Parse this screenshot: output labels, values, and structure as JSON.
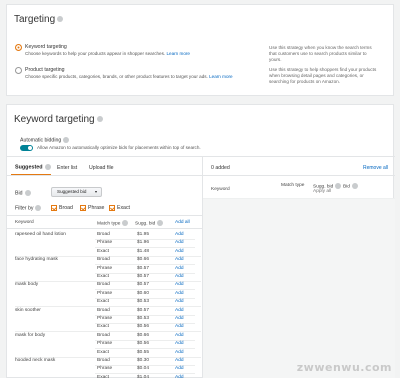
{
  "targeting": {
    "title": "Targeting",
    "auto_label": "Keyword targeting",
    "auto_desc": "Choose keywords to help your products appear in shopper searches.",
    "auto_link": "Learn more",
    "manual_label": "Product targeting",
    "manual_desc": "Choose specific products, categories, brands, or other product features to target your ads.",
    "manual_link": "Learn more",
    "side_text_1": "Use this strategy when you know the search terms",
    "side_text_2": "that customers use to search products similar to",
    "side_text_3": "yours.",
    "side_text_4": "Use this strategy to help shoppers find your products",
    "side_text_5": "when browsing detail pages and categories, or",
    "side_text_6": "searching for products on Amazon."
  },
  "keyword_targeting": {
    "title": "Keyword targeting",
    "auto_bids_label": "Automatic bidding",
    "auto_bids_desc": "Allow Amazon to automatically optimize bids for placements within top of search.",
    "tabs": [
      "Suggested",
      "Enter list",
      "Upload file"
    ],
    "bid_label": "Bid",
    "bid_select": "Suggested bid",
    "filter_label": "Filter by",
    "filters": [
      "Broad",
      "Phrase",
      "Exact"
    ],
    "table_headers": {
      "keyword": "Keyword",
      "match": "Match type",
      "sugg": "Sugg. bid",
      "add_all": "Add all"
    },
    "rows": [
      {
        "keyword": "rapeseed oil hand lotion",
        "items": [
          {
            "match": "Broad",
            "bid": "$1.95"
          },
          {
            "match": "Phrase",
            "bid": "$1.96"
          },
          {
            "match": "Exact",
            "bid": "$1.48"
          }
        ]
      },
      {
        "keyword": "face hydrating mask",
        "items": [
          {
            "match": "Broad",
            "bid": "$0.66"
          },
          {
            "match": "Phrase",
            "bid": "$0.57"
          },
          {
            "match": "Exact",
            "bid": "$0.57"
          }
        ]
      },
      {
        "keyword": "mask body",
        "items": [
          {
            "match": "Broad",
            "bid": "$0.57"
          },
          {
            "match": "Phrase",
            "bid": "$0.60"
          },
          {
            "match": "Exact",
            "bid": "$0.53"
          }
        ]
      },
      {
        "keyword": "skin soother",
        "items": [
          {
            "match": "Broad",
            "bid": "$0.57"
          },
          {
            "match": "Phrase",
            "bid": "$0.53"
          },
          {
            "match": "Exact",
            "bid": "$0.56"
          }
        ]
      },
      {
        "keyword": "mask for body",
        "items": [
          {
            "match": "Broad",
            "bid": "$0.66"
          },
          {
            "match": "Phrase",
            "bid": "$0.56"
          },
          {
            "match": "Exact",
            "bid": "$0.55"
          }
        ]
      },
      {
        "keyword": "hooded neck mask",
        "items": [
          {
            "match": "Broad",
            "bid": "$0.30"
          },
          {
            "match": "Phrase",
            "bid": "$0.04"
          },
          {
            "match": "Exact",
            "bid": "$1.04"
          }
        ]
      }
    ],
    "add_label": "Add",
    "added_title": "0 added",
    "remove_all": "Remove all",
    "added_headers": {
      "keyword": "Keyword",
      "match": "Match type",
      "sugg": "Sugg. bid",
      "bid": "Bid"
    },
    "added_sub": "Apply all"
  },
  "watermark": "zwwenwu.com"
}
